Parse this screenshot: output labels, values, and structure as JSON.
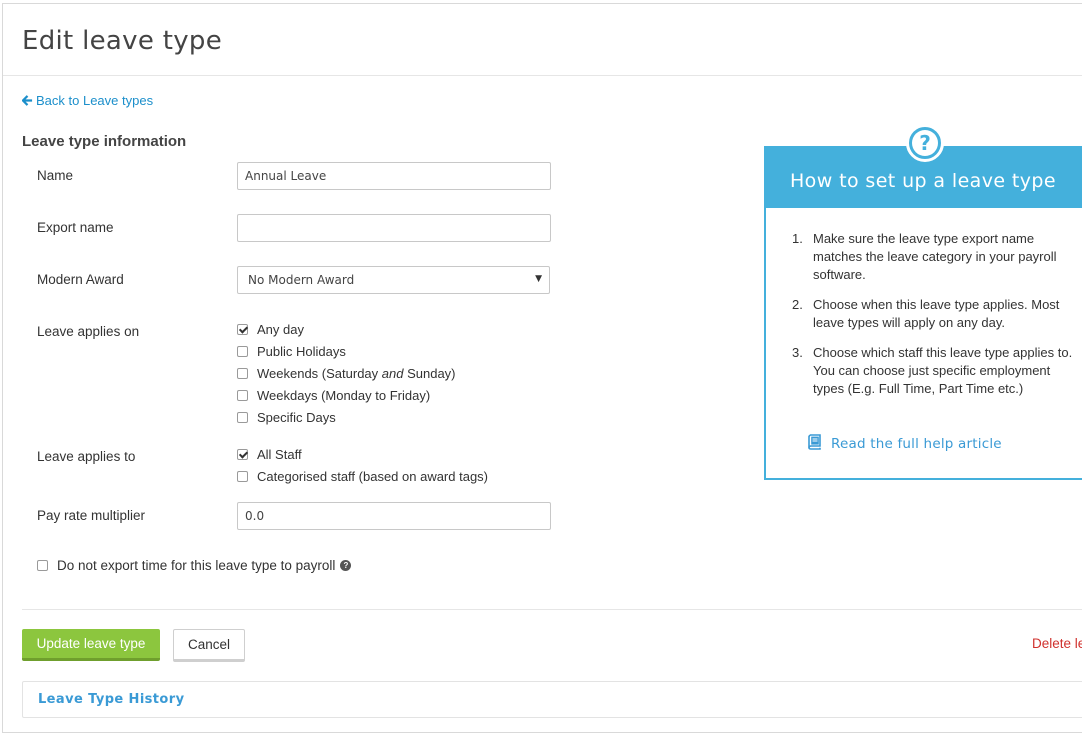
{
  "page": {
    "title": "Edit leave type"
  },
  "nav": {
    "back_label": "Back to Leave types"
  },
  "form": {
    "section_title": "Leave type information",
    "name": {
      "label": "Name",
      "value": "Annual Leave"
    },
    "export_name": {
      "label": "Export name",
      "value": ""
    },
    "modern_award": {
      "label": "Modern Award",
      "selected": "No Modern Award"
    },
    "applies_on": {
      "label": "Leave applies on",
      "options": [
        {
          "label": "Any day",
          "checked": true
        },
        {
          "label": "Public Holidays",
          "checked": false
        },
        {
          "label_pre": "Weekends (Saturday ",
          "label_em": "and",
          "label_post": " Sunday)",
          "checked": false
        },
        {
          "label": "Weekdays (Monday to Friday)",
          "checked": false
        },
        {
          "label": "Specific Days",
          "checked": false
        }
      ]
    },
    "applies_to": {
      "label": "Leave applies to",
      "options": [
        {
          "label": "All Staff",
          "checked": true
        },
        {
          "label": "Categorised staff (based on award tags)",
          "checked": false
        }
      ]
    },
    "pay_rate": {
      "label": "Pay rate multiplier",
      "value": "0.0"
    },
    "no_export": {
      "label": "Do not export time for this leave type to payroll",
      "checked": false,
      "help_glyph": "?"
    }
  },
  "actions": {
    "update_label": "Update leave type",
    "cancel_label": "Cancel",
    "delete_label": "Delete leave type"
  },
  "history": {
    "label": "Leave Type History"
  },
  "help": {
    "icon_glyph": "?",
    "title": "How to set up a leave type",
    "steps": [
      {
        "num": "1.",
        "text": "Make sure the leave type export name matches the leave category in your payroll software."
      },
      {
        "num": "2.",
        "text": "Choose when this leave type applies. Most leave types will apply on any day."
      },
      {
        "num": "3.",
        "text": "Choose which staff this leave type applies to.  You can choose just specific employment types (E.g. Full Time, Part Time etc.)"
      }
    ],
    "article_label": "Read the full help article"
  },
  "colors": {
    "accent_blue": "#44b0dc",
    "link_blue": "#1c8fcb",
    "primary_green": "#8cc63e",
    "danger_red": "#d0312d"
  }
}
